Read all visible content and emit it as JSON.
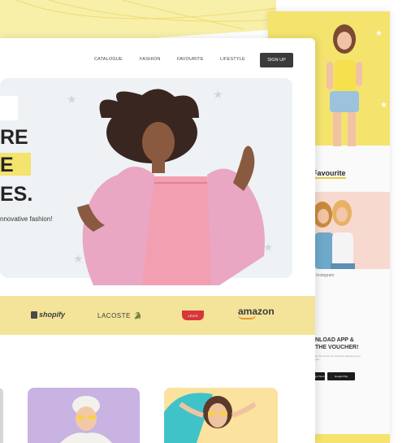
{
  "nav": {
    "items": [
      "CATALOGUE",
      "FASHION",
      "FAVOURITE",
      "LIFESTYLE"
    ],
    "signup_label": "SIGN UP"
  },
  "hero": {
    "headline_lines": [
      "RE",
      "E",
      "ES."
    ],
    "subtitle": "nnovative fashion!"
  },
  "brands": {
    "shopify": "shopify",
    "lacoste": "LACOSTE",
    "levis": "LEVI'S",
    "amazon": "amazon"
  },
  "back_page": {
    "favourite_title": "Favourite",
    "instagram_caption": "n Instagram",
    "download_line1": "NLOAD APP &",
    "download_line2": "THE VOUCHER!",
    "download_sub": "ion the stores for using the special app for you.",
    "app_store": "App Store",
    "google_play": "Google Play"
  },
  "colors": {
    "accent_yellow": "#f4e36d",
    "dark_button": "#3b3b3b",
    "hero_bg": "#eef2f4",
    "levis_red": "#d8373a"
  }
}
